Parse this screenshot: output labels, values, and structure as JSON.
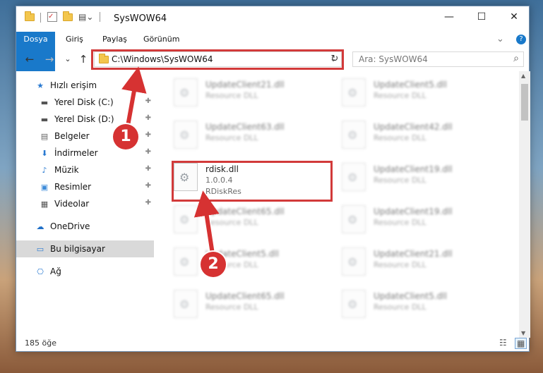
{
  "window": {
    "title": "SysWOW64",
    "controls": {
      "minimize": "—",
      "maximize": "☐",
      "close": "✕"
    }
  },
  "ribbon": {
    "tabs": [
      "Dosya",
      "Giriş",
      "Paylaş",
      "Görünüm"
    ],
    "expand_icon": "⌄",
    "help_icon": "?"
  },
  "navigation": {
    "back": "←",
    "forward": "→",
    "recent": "⌄",
    "up": "↑",
    "address": "C:\\Windows\\SysWOW64",
    "address_dropdown": "⌄",
    "refresh": "↻",
    "search_placeholder": "Ara: SysWOW64",
    "search_icon": "⌕"
  },
  "sidebar": {
    "items": [
      {
        "label": "Hızlı erişim",
        "icon": "star-icon",
        "glyph": "★",
        "pinned": false
      },
      {
        "label": "Yerel Disk (C:)",
        "icon": "drive-icon",
        "glyph": "▬",
        "pinned": true
      },
      {
        "label": "Yerel Disk (D:)",
        "icon": "drive-icon",
        "glyph": "▬",
        "pinned": true
      },
      {
        "label": "Belgeler",
        "icon": "document-icon",
        "glyph": "▤",
        "pinned": true
      },
      {
        "label": "İndirmeler",
        "icon": "download-icon",
        "glyph": "⬇",
        "pinned": true
      },
      {
        "label": "Müzik",
        "icon": "music-icon",
        "glyph": "♪",
        "pinned": true
      },
      {
        "label": "Resimler",
        "icon": "pictures-icon",
        "glyph": "▣",
        "pinned": true
      },
      {
        "label": "Videolar",
        "icon": "video-icon",
        "glyph": "▦",
        "pinned": true
      },
      {
        "label": "OneDrive",
        "icon": "cloud-icon",
        "glyph": "☁",
        "pinned": false
      },
      {
        "label": "Bu bilgisayar",
        "icon": "computer-icon",
        "glyph": "▭",
        "pinned": false
      },
      {
        "label": "Ağ",
        "icon": "network-icon",
        "glyph": "⎔",
        "pinned": false
      }
    ],
    "pin_glyph": "📌"
  },
  "files": {
    "left_column": [
      {
        "name": "UpdateClient21.dll",
        "desc": "Resource DLL"
      },
      {
        "name": "UpdateClient63.dll",
        "desc": "Resource DLL"
      },
      {
        "name": "rdisk.dll",
        "version": "1.0.0.4",
        "desc": "RDiskRes"
      },
      {
        "name": "UpdateClient65.dll",
        "desc": "Resource DLL"
      },
      {
        "name": "UpdateClient5.dll",
        "desc": "Resource DLL"
      },
      {
        "name": "UpdateClient65.dll",
        "desc": "Resource DLL"
      }
    ],
    "right_column": [
      {
        "name": "UpdateClient5.dll",
        "desc": "Resource DLL"
      },
      {
        "name": "UpdateClient42.dll",
        "desc": "Resource DLL"
      },
      {
        "name": "UpdateClient19.dll",
        "desc": "Resource DLL"
      },
      {
        "name": "UpdateClient19.dll",
        "desc": "Resource DLL"
      },
      {
        "name": "UpdateClient21.dll",
        "desc": "Resource DLL"
      },
      {
        "name": "UpdateClient5.dll",
        "desc": "Resource DLL"
      }
    ]
  },
  "status": {
    "item_count": "185 öğe"
  },
  "annotations": {
    "step1": "1",
    "step2": "2"
  },
  "colors": {
    "highlight_red": "#d23a3a",
    "file_tab_blue": "#1979ca",
    "folder_yellow": "#f3c64d"
  }
}
